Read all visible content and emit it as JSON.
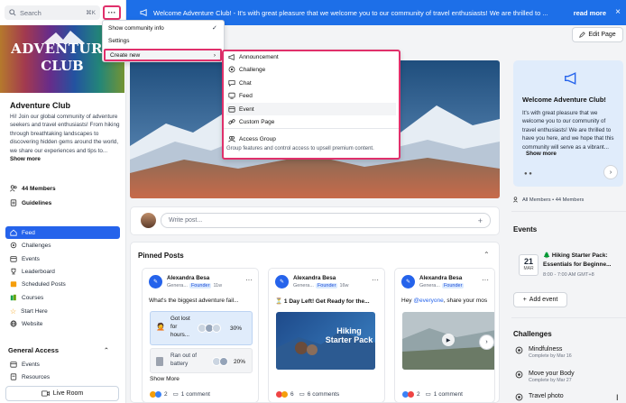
{
  "search": {
    "placeholder": "Search",
    "shortcut": "⌘K"
  },
  "dots_label": "···",
  "community": {
    "logo_line1": "ADVENTURE",
    "logo_line2": "CLUB",
    "name": "Adventure Club",
    "description": "Hi! Join our global community of adventure seekers and travel enthusiasts! From hiking through breathtaking landscapes to discovering hidden gems around the world, we share our experiences and tips to...",
    "show_more": "Show more",
    "members": "44 Members",
    "guidelines": "Guidelines"
  },
  "nav": [
    {
      "label": "Feed",
      "icon": "home-icon",
      "active": true
    },
    {
      "label": "Challenges",
      "icon": "challenge-icon",
      "active": false
    },
    {
      "label": "Events",
      "icon": "calendar-icon",
      "active": false
    },
    {
      "label": "Leaderboard",
      "icon": "trophy-icon",
      "active": false
    },
    {
      "label": "Scheduled Posts",
      "icon": "scheduled-icon",
      "active": false
    },
    {
      "label": "Courses",
      "icon": "courses-icon",
      "active": false
    },
    {
      "label": "Start Here",
      "icon": "star-icon",
      "active": false
    },
    {
      "label": "Website",
      "icon": "globe-icon",
      "active": false
    }
  ],
  "general_access": {
    "title": "General Access",
    "items": [
      {
        "label": "Events",
        "icon": "calendar-icon"
      },
      {
        "label": "Resources",
        "icon": "link-icon"
      }
    ]
  },
  "live_room": "Live Room",
  "banner": {
    "text": "Welcome Adventure Club! - It's with great pleasure that we welcome you to our community of travel enthusiasts! We are thrilled to ...",
    "read_more": "read more",
    "close": "×"
  },
  "edit_page": "Edit Page",
  "composer": {
    "placeholder": "Write post...",
    "plus": "+"
  },
  "pinned": {
    "title": "Pinned Posts",
    "show_more": "Show More",
    "cards": [
      {
        "author": "Alexandra Besa",
        "group": "Genera...",
        "badge": "Founder",
        "time": "11w",
        "title": "What's the biggest adventure fail...",
        "poll": [
          {
            "text": "Got lost for hours...",
            "percent": "30%"
          },
          {
            "text": "Ran out of battery",
            "percent": "20%"
          }
        ],
        "reactions": "2",
        "comments": "1 comment"
      },
      {
        "author": "Alexandra Besa",
        "group": "Genera...",
        "badge": "Founder",
        "time": "16w",
        "title": "⏳ 1 Day Left! Get Ready for the...",
        "image_text": "Hiking Starter Pack",
        "reactions": "6",
        "comments": "6 comments"
      },
      {
        "author": "Alexandra Besa",
        "group": "Genera...",
        "badge": "Founder",
        "time": "",
        "title_prefix": "Hey ",
        "mention": "@everyone",
        "title_rest": ", share your mos",
        "reactions": "2",
        "comments": "1 comment"
      }
    ]
  },
  "welcome": {
    "title": "Welcome Adventure Club!",
    "text": "It's with great pleasure that we welcome you to our community of travel enthusiasts! We are thrilled to have you here, and we hope that this community will serve as a vibrant...",
    "show_more": "Show more"
  },
  "members_line": "All Members • 44 Members",
  "events": {
    "title": "Events",
    "item": {
      "day": "21",
      "month": "MAR",
      "title": "🌲 Hiking Starter Pack: Essentials for Beginne...",
      "time": "8:00 - 7:00 AM GMT+8"
    },
    "add": "Add event"
  },
  "challenges": {
    "title": "Challenges",
    "items": [
      {
        "title": "Mindfulness",
        "sub": "Complete by Mar 16"
      },
      {
        "title": "Move your Body",
        "sub": "Complete by Mar 27"
      },
      {
        "title": "Travel photo",
        "sub": ""
      }
    ]
  },
  "menu": {
    "items": [
      "Show community info",
      "Settings"
    ],
    "create_new": "Create new"
  },
  "create_menu": {
    "items": [
      {
        "label": "Announcement",
        "icon": "megaphone-icon"
      },
      {
        "label": "Challenge",
        "icon": "challenge-icon"
      },
      {
        "label": "Chat",
        "icon": "chat-icon"
      },
      {
        "label": "Feed",
        "icon": "feed-icon"
      },
      {
        "label": "Event",
        "icon": "calendar-icon"
      },
      {
        "label": "Custom Page",
        "icon": "link-icon"
      },
      {
        "label": "Access Group",
        "icon": "access-group-icon"
      }
    ],
    "note": "Group features and control access to upsell premium content."
  },
  "colors": {
    "accent": "#1d6fe8",
    "highlight": "#e0306b"
  }
}
